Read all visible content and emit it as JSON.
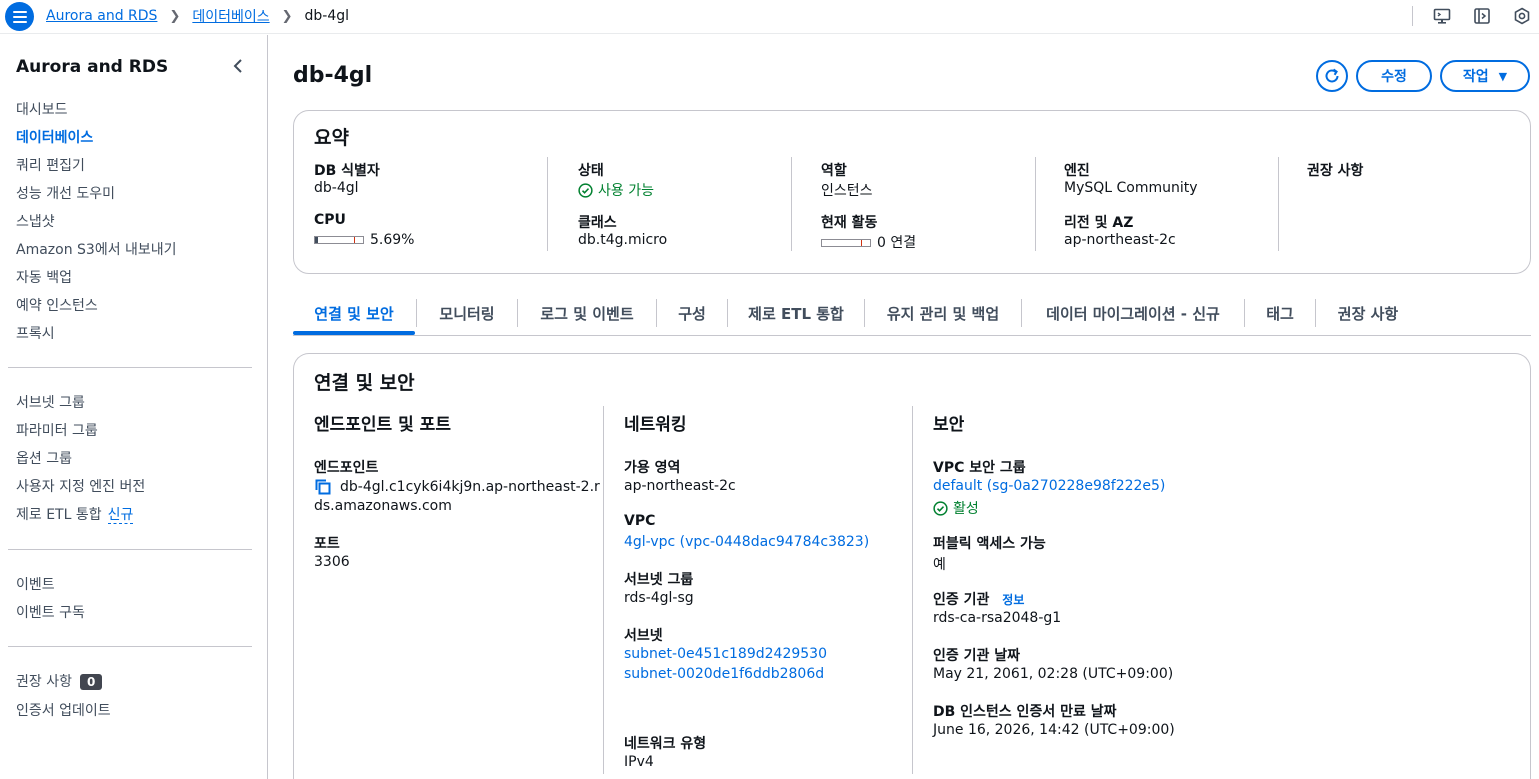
{
  "breadcrumb": {
    "items": [
      "Aurora and RDS",
      "데이터베이스"
    ],
    "current": "db-4gl"
  },
  "top_icons": [
    "cloudshell-icon",
    "console-toolbar-icon",
    "settings-icon"
  ],
  "sidebar": {
    "title": "Aurora and RDS",
    "items": [
      "대시보드",
      "데이터베이스",
      "쿼리 편집기",
      "성능 개선 도우미",
      "스냅샷",
      "Amazon S3에서 내보내기",
      "자동 백업",
      "예약 인스턴스",
      "프록시"
    ],
    "items2": [
      "서브넷 그룹",
      "파라미터 그룹",
      "옵션 그룹",
      "사용자 지정 엔진 버전",
      "제로 ETL 통합"
    ],
    "new_label": "신규",
    "items3": [
      "이벤트",
      "이벤트 구독"
    ],
    "recommendations": "권장 사항",
    "recommendations_count": "0",
    "cert_update": "인증서 업데이트"
  },
  "page": {
    "title": "db-4gl",
    "edit_label": "수정",
    "action_label": "작업"
  },
  "summary": {
    "title": "요약",
    "db_id_label": "DB 식별자",
    "db_id": "db-4gl",
    "cpu_label": "CPU",
    "cpu_value": "5.69%",
    "cpu_fraction": 0.0569,
    "status_label": "상태",
    "status_value": "사용 가능",
    "class_label": "클래스",
    "class_value": "db.t4g.micro",
    "role_label": "역할",
    "role_value": "인스턴스",
    "activity_label": "현재 활동",
    "activity_value": "0 연결",
    "engine_label": "엔진",
    "engine_value": "MySQL Community",
    "region_label": "리전 및 AZ",
    "region_value": "ap-northeast-2c",
    "recommend_label": "권장 사항"
  },
  "tabs": [
    "연결 및 보안",
    "모니터링",
    "로그 및 이벤트",
    "구성",
    "제로 ETL 통합",
    "유지 관리 및 백업",
    "데이터 마이그레이션 - 신규",
    "태그",
    "권장 사항"
  ],
  "connectivity": {
    "title": "연결 및 보안",
    "endpoint_section": "엔드포인트 및 포트",
    "endpoint_label": "엔드포인트",
    "endpoint_line1": "db-4gl.c1cyk6i4kj9n.ap-northeast-2.r",
    "endpoint_line2": "ds.amazonaws.com",
    "port_label": "포트",
    "port_value": "3306",
    "network_section": "네트워킹",
    "az_label": "가용 영역",
    "az_value": "ap-northeast-2c",
    "vpc_label": "VPC",
    "vpc_value": "4gl-vpc (vpc-0448dac94784c3823)",
    "subnet_group_label": "서브넷 그룹",
    "subnet_group_value": "rds-4gl-sg",
    "subnets_label": "서브넷",
    "subnet1": "subnet-0e451c189d2429530",
    "subnet2": "subnet-0020de1f6ddb2806d",
    "network_type_label": "네트워크 유형",
    "network_type_value": "IPv4",
    "security_section": "보안",
    "sg_label": "VPC 보안 그룹",
    "sg_value": "default (sg-0a270228e98f222e5)",
    "sg_status": "활성",
    "public_label": "퍼블릭 액세스 가능",
    "public_value": "예",
    "ca_label": "인증 기관",
    "ca_info": "정보",
    "ca_value": "rds-ca-rsa2048-g1",
    "ca_date_label": "인증 기관 날짜",
    "ca_date_value": "May 21, 2061, 02:28 (UTC+09:00)",
    "cert_exp_label": "DB 인스턴스 인증서 만료 날짜",
    "cert_exp_value": "June 16, 2026, 14:42 (UTC+09:00)"
  },
  "colors": {
    "accent": "#006ce0",
    "success": "#00802f",
    "border": "#c6c6cd"
  }
}
